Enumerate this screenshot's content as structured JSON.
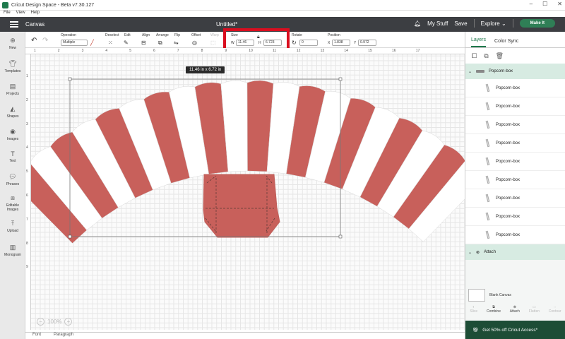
{
  "window": {
    "title": "Cricut Design Space - Beta v7.30.127",
    "controls": [
      "–",
      "☐",
      "✕"
    ]
  },
  "menu": [
    "File",
    "View",
    "Help"
  ],
  "header": {
    "canvas_label": "Canvas",
    "doc_title": "Untitled*",
    "my_stuff": "My Stuff",
    "save": "Save",
    "explore": "Explore",
    "make_it": "Make It"
  },
  "toolbar": {
    "operation_label": "Operation",
    "operation_value": "Multiple",
    "deselect": "Deselect",
    "edit": "Edit",
    "align": "Align",
    "arrange": "Arrange",
    "flip": "Flip",
    "offset": "Offset",
    "warp": "Warp",
    "size_label": "Size",
    "width_label": "W",
    "width_value": "11.46",
    "height_label": "H",
    "height_value": "6.723",
    "rotate_label": "Rotate",
    "rotate_value": "0",
    "position_label": "Position",
    "x_label": "X",
    "x_value": "1.838",
    "y_label": "Y",
    "y_value": "0.972"
  },
  "leftbar": [
    "New",
    "Templates",
    "Projects",
    "Shapes",
    "Images",
    "Text",
    "Phrases",
    "Editable Images",
    "Upload",
    "Monogram"
  ],
  "ruler_top": [
    "1",
    "2",
    "3",
    "4",
    "5",
    "6",
    "7",
    "8",
    "9",
    "10",
    "11",
    "12",
    "13",
    "14",
    "15",
    "16",
    "17"
  ],
  "ruler_left": [
    "1",
    "2",
    "3",
    "4",
    "5",
    "6",
    "7",
    "8",
    "9"
  ],
  "canvas": {
    "dimension_tip": "11.46 in x 6.72 in",
    "zoom": "100%",
    "stripe_colors": [
      "#c8605b",
      "#ffffff"
    ],
    "base_color": "#c8605b"
  },
  "bottom": {
    "left": "Font",
    "right": "Paragraph"
  },
  "layers": {
    "tabs": [
      "Layers",
      "Color Sync"
    ],
    "group_name": "Popcorn-box",
    "children": [
      "Popcorn-box",
      "Popcorn-box",
      "Popcorn-box",
      "Popcorn-box",
      "Popcorn-box",
      "Popcorn-box",
      "Popcorn-box",
      "Popcorn-box",
      "Popcorn-box"
    ],
    "attach_label": "Attach",
    "blank_canvas": "Blank Canvas",
    "actions": [
      "Slice",
      "Combine",
      "Attach",
      "Flatten",
      "Contour"
    ],
    "promo": "Get 50% off Cricut Access*"
  }
}
